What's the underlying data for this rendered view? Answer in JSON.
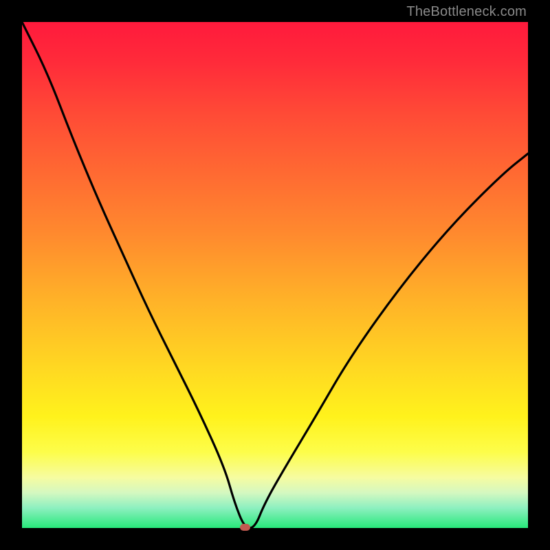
{
  "watermark": "TheBottleneck.com",
  "colors": {
    "frame": "#000000",
    "curve": "#000000",
    "marker": "#c25a50",
    "gradient_top": "#ff1a3c",
    "gradient_bottom": "#27e87a"
  },
  "chart_data": {
    "type": "line",
    "title": "",
    "xlabel": "",
    "ylabel": "",
    "xlim": [
      0,
      100
    ],
    "ylim": [
      0,
      100
    ],
    "grid": false,
    "legend": false,
    "annotations": [
      {
        "name": "marker",
        "x": 44,
        "y": 0,
        "shape": "rounded-rect",
        "color": "#c25a50"
      }
    ],
    "series": [
      {
        "name": "bottleneck-curve",
        "x": [
          0,
          5,
          10,
          15,
          20,
          25,
          30,
          35,
          40,
          42,
          44,
          46,
          48,
          52,
          58,
          65,
          75,
          85,
          95,
          100
        ],
        "y": [
          100,
          90,
          77,
          65,
          54,
          43,
          33,
          23,
          12,
          5,
          0,
          0,
          5,
          12,
          22,
          34,
          48,
          60,
          70,
          74
        ]
      }
    ],
    "background_gradient": {
      "axis": "y",
      "stops": [
        {
          "pos": 0,
          "color": "#27e87a"
        },
        {
          "pos": 7,
          "color": "#d5f8c0"
        },
        {
          "pos": 15,
          "color": "#fdfd4a"
        },
        {
          "pos": 32,
          "color": "#ffd722"
        },
        {
          "pos": 58,
          "color": "#ff8a2e"
        },
        {
          "pos": 82,
          "color": "#ff4a36"
        },
        {
          "pos": 100,
          "color": "#ff1a3c"
        }
      ]
    }
  }
}
